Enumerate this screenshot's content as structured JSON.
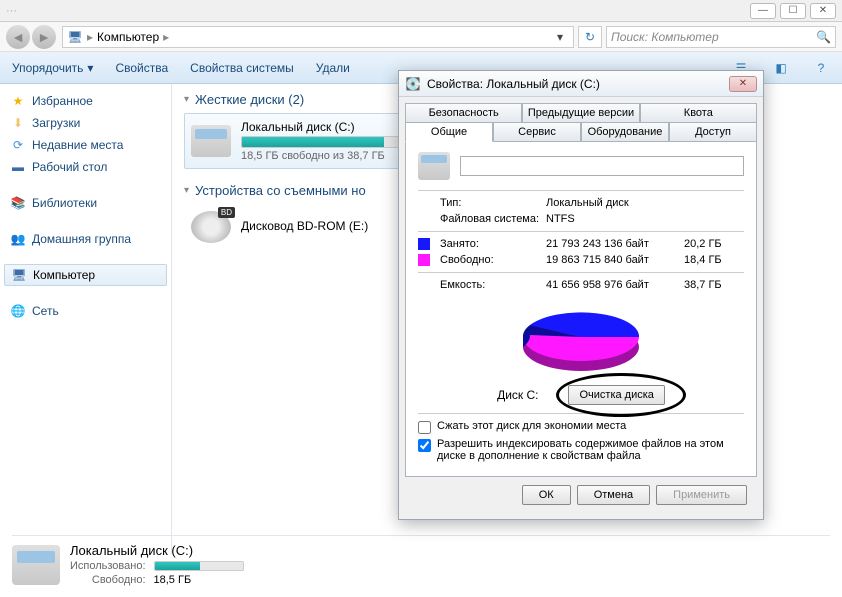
{
  "window_controls": {
    "min": "—",
    "max": "☐",
    "close": "✕"
  },
  "address": {
    "root_icon": "computer",
    "crumbs": [
      "Компьютер"
    ],
    "search_placeholder": "Поиск: Компьютер"
  },
  "toolbar": {
    "organize": "Упорядочить",
    "properties": "Свойства",
    "system_props": "Свойства системы",
    "uninstall": "Удали"
  },
  "sidebar": {
    "favorites": {
      "label": "Избранное",
      "items": [
        "Загрузки",
        "Недавние места",
        "Рабочий стол"
      ]
    },
    "libraries": "Библиотеки",
    "homegroup": "Домашняя группа",
    "computer": "Компьютер",
    "network": "Сеть"
  },
  "content": {
    "hdd_header": "Жесткие диски (2)",
    "removable_header": "Устройства со съемными но",
    "drive_c": {
      "name": "Локальный диск (C:)",
      "free_text": "18,5 ГБ свободно из 38,7 ГБ",
      "fill_pct": 52
    },
    "bd_rom": {
      "name": "Дисковод BD-ROM (E:)"
    }
  },
  "statusbar": {
    "title": "Локальный диск (C:)",
    "used_label": "Использовано:",
    "free_label": "Свободно:",
    "free_value": "18,5 ГБ",
    "fill_pct": 52
  },
  "dialog": {
    "title": "Свойства: Локальный диск (C:)",
    "tabs_row1": [
      "Безопасность",
      "Предыдущие версии",
      "Квота"
    ],
    "tabs_row2": [
      "Общие",
      "Сервис",
      "Оборудование",
      "Доступ"
    ],
    "active_tab": "Общие",
    "volume_label": "",
    "type_label": "Тип:",
    "type_value": "Локальный диск",
    "fs_label": "Файловая система:",
    "fs_value": "NTFS",
    "used_label": "Занято:",
    "used_bytes": "21 793 243 136 байт",
    "used_gb": "20,2 ГБ",
    "free_label": "Свободно:",
    "free_bytes": "19 863 715 840 байт",
    "free_gb": "18,4 ГБ",
    "cap_label": "Емкость:",
    "cap_bytes": "41 656 958 976 байт",
    "cap_gb": "38,7 ГБ",
    "disk_label": "Диск C:",
    "cleanup": "Очистка диска",
    "compress": "Сжать этот диск для экономии места",
    "index": "Разрешить индексировать содержимое файлов на этом диске в дополнение к свойствам файла",
    "ok": "ОК",
    "cancel": "Отмена",
    "apply": "Применить"
  },
  "chart_data": {
    "type": "pie",
    "title": "Диск C:",
    "series": [
      {
        "name": "Занято",
        "value": 21793243136,
        "display": "20,2 ГБ",
        "color": "#1818ff"
      },
      {
        "name": "Свободно",
        "value": 19863715840,
        "display": "18,4 ГБ",
        "color": "#ff18ff"
      }
    ],
    "total": {
      "name": "Емкость",
      "value": 41656958976,
      "display": "38,7 ГБ"
    }
  }
}
